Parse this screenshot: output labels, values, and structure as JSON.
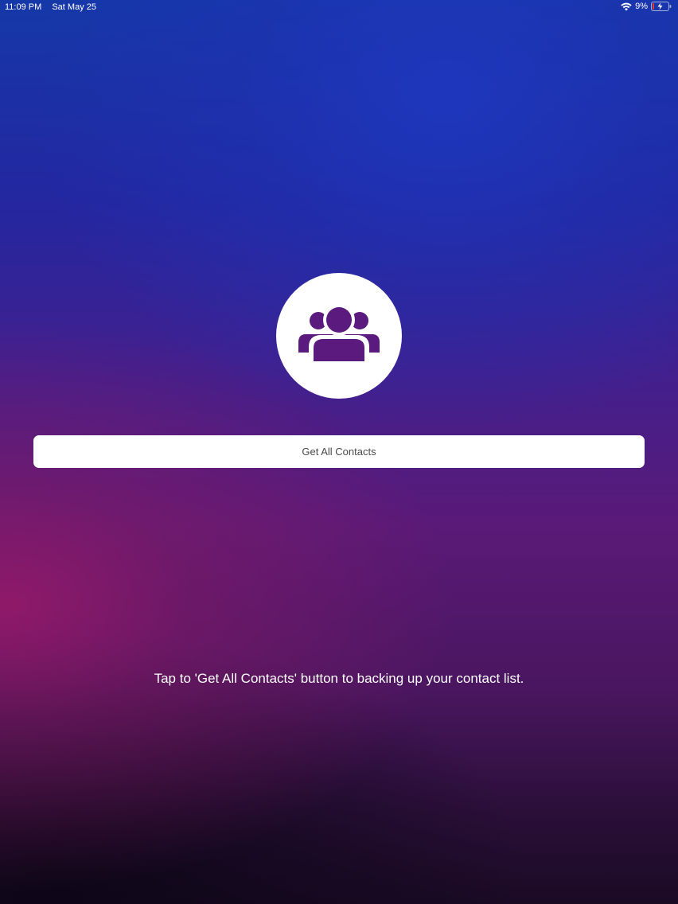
{
  "status_bar": {
    "time": "11:09 PM",
    "date": "Sat May 25",
    "battery_percent": "9%",
    "wifi_icon": "wifi-icon",
    "battery_icon": "battery-charging-icon"
  },
  "main": {
    "icon": "contacts-group-icon",
    "button_label": "Get All Contacts",
    "instruction": "Tap to 'Get All Contacts' button to backing up your contact list."
  },
  "colors": {
    "background_top": "#1538a8",
    "background_mid": "#5a1a78",
    "background_bottom": "#1a0a24",
    "accent": "#5b1a7e",
    "button_bg": "#ffffff",
    "button_text": "#4a4a4a",
    "battery_low": "#e53935"
  }
}
